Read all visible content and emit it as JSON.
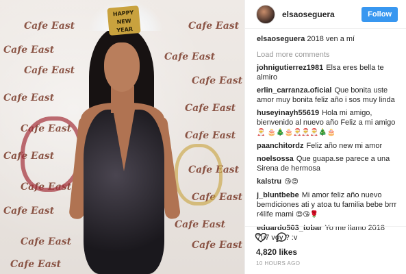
{
  "post": {
    "username": "elsaoseguera",
    "follow_label": "Follow",
    "caption_user": "elsaoseguera",
    "caption_text": "2018 ven a mí",
    "load_more": "Load more comments",
    "photo_logo_text": "Cafe East",
    "crown_text": "HAPPY NEW YEAR"
  },
  "comments": [
    {
      "user": "johnigutierrez1981",
      "text": "Elsa eres bella te almiro",
      "emoji": ""
    },
    {
      "user": "erlin_carranza.oficial",
      "text": "Que bonita uste amor muy bonita feliz año i sos muy linda",
      "emoji": ""
    },
    {
      "user": "huseyinayh55619",
      "text": "Hola mi amigo, bienvenido al nuevo año Feliz a mi amigo",
      "emoji": "🎅 🎂🎄🎂🎅🎅🎅🎄🎂"
    },
    {
      "user": "paanchitordz",
      "text": "Feliz año new mi amor",
      "emoji": ""
    },
    {
      "user": "noelsossa",
      "text": "Que guapa.se parece a una Sirena de hermosa",
      "emoji": ""
    },
    {
      "user": "kalstru",
      "text": "",
      "emoji": "😘😍"
    },
    {
      "user": "j_bluntbebe",
      "text": "Mi amor feliz año nuevo bemdiciones ati y atoa tu familia bebe brrr r4life mami",
      "emoji": "😍😘🌹"
    },
    {
      "user": "eduardo503_tobar",
      "text": "Yo me llamo 2018 7u7 voy ? :v",
      "emoji": ""
    }
  ],
  "footer": {
    "likes": "4,820 likes",
    "time": "10 HOURS AGO"
  },
  "icons": [
    "heart-icon",
    "comment-icon"
  ]
}
